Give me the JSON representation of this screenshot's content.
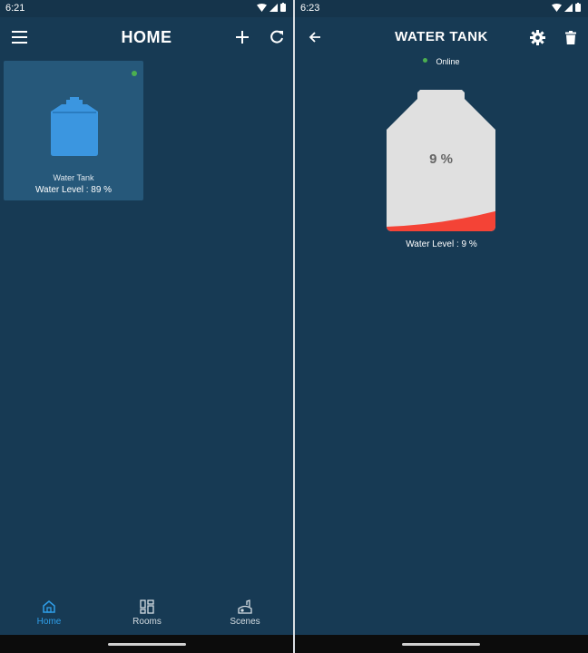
{
  "left": {
    "status": {
      "time": "6:21"
    },
    "appbar": {
      "title": "HOME",
      "menu_icon": "menu-icon",
      "add_icon": "add-icon",
      "refresh_icon": "refresh-icon"
    },
    "device_card": {
      "name": "Water Tank",
      "level_text": "Water Level : 89 %",
      "status_color": "#4caf50",
      "icon": "water-tank-icon",
      "icon_color": "#3b96e0"
    },
    "bottom_nav": [
      {
        "label": "Home",
        "icon": "home-icon",
        "active": true
      },
      {
        "label": "Rooms",
        "icon": "rooms-icon",
        "active": false
      },
      {
        "label": "Scenes",
        "icon": "scenes-icon",
        "active": false
      }
    ]
  },
  "right": {
    "status": {
      "time": "6:23"
    },
    "appbar": {
      "title": "WATER TANK",
      "back_icon": "back-arrow-icon",
      "settings_icon": "gear-icon",
      "delete_icon": "trash-icon"
    },
    "status_text": "Online",
    "tank": {
      "percent_text": "9 %",
      "fill_fraction": 0.09,
      "fill_color": "#f44336",
      "body_color": "#e0e0e0"
    },
    "water_level_text": "Water Level  : 9 %"
  },
  "colors": {
    "background": "#173a54",
    "accent": "#2f9ee8",
    "online": "#4caf50"
  }
}
